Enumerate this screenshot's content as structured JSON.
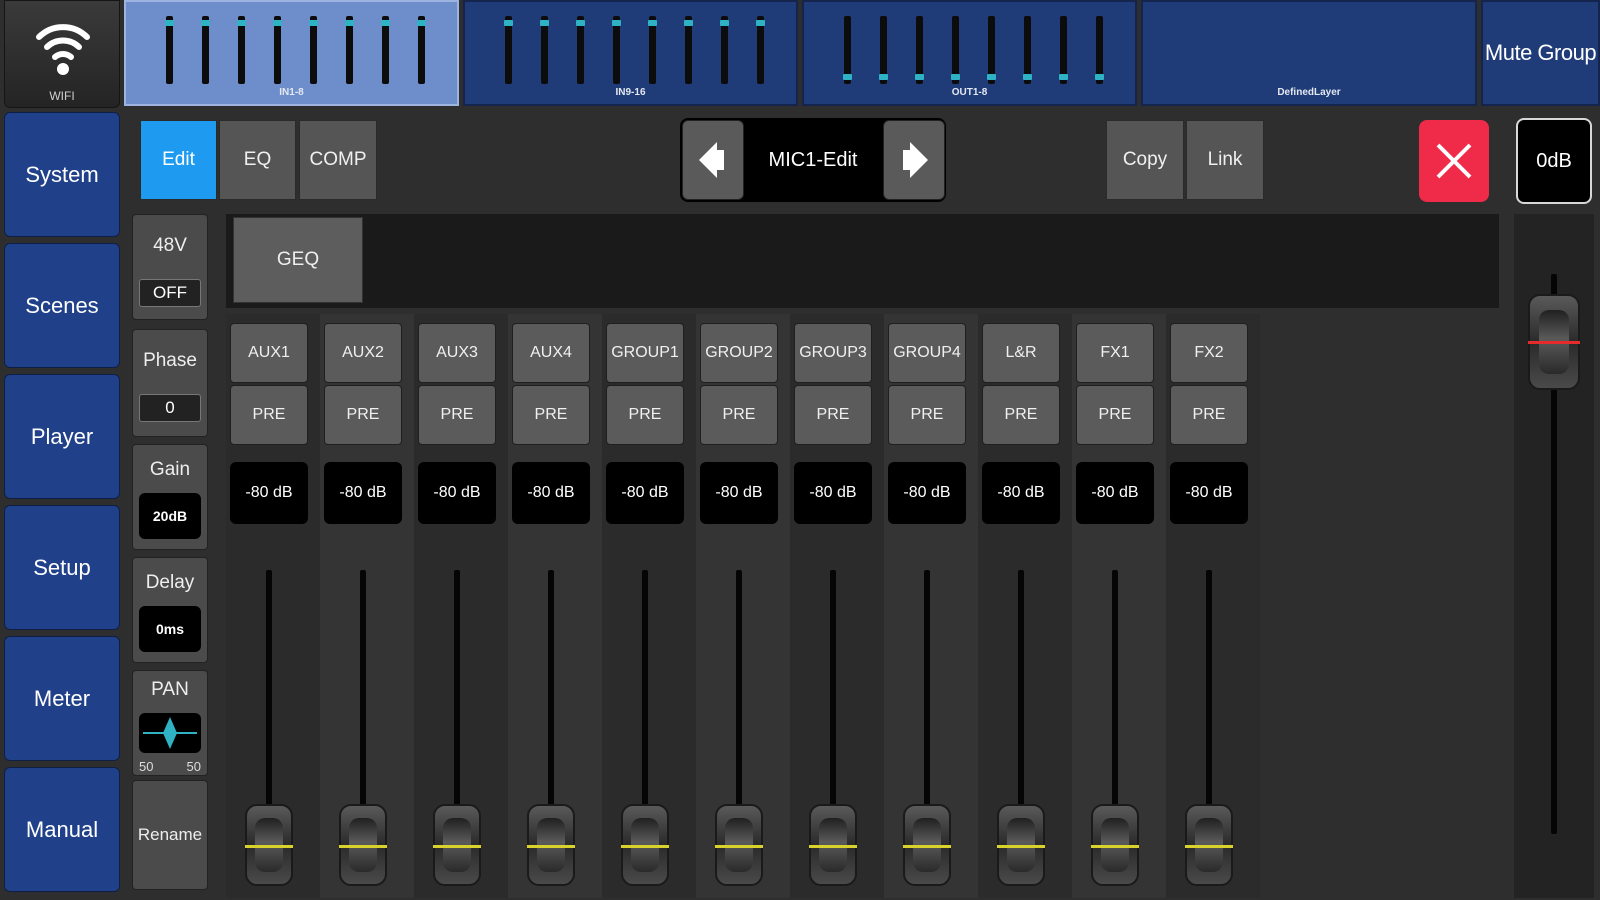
{
  "wifi": {
    "label": "WIFI"
  },
  "layers": [
    {
      "name": "IN1-8",
      "active": true,
      "faders": 8
    },
    {
      "name": "IN9-16",
      "active": false,
      "faders": 8
    },
    {
      "name": "OUT1-8",
      "active": false,
      "faders": 8
    },
    {
      "name": "DefinedLayer",
      "active": false,
      "faders": 0
    }
  ],
  "mute_group": {
    "label": "Mute Group"
  },
  "nav": [
    "System",
    "Scenes",
    "Player",
    "Setup",
    "Meter",
    "Manual"
  ],
  "toolbar": {
    "tabs": [
      "Edit",
      "EQ",
      "COMP"
    ],
    "active_tab": "Edit",
    "channel_name": "MIC1-Edit",
    "copy_label": "Copy",
    "link_label": "Link",
    "master_db": "0dB",
    "colors": {
      "accent": "#1e9bf0",
      "close": "#f02a49",
      "layer": "#1f3c78",
      "nav": "#20418a"
    }
  },
  "params": {
    "phantom": {
      "label": "48V",
      "value": "OFF"
    },
    "phase": {
      "label": "Phase",
      "value": "0"
    },
    "gain": {
      "label": "Gain",
      "value": "20dB"
    },
    "delay": {
      "label": "Delay",
      "value": "0ms"
    },
    "pan": {
      "label": "PAN",
      "left": "50",
      "right": "50"
    },
    "rename_label": "Rename"
  },
  "geq_label": "GEQ",
  "sends": [
    {
      "name": "AUX1",
      "mode": "PRE",
      "level": "-80 dB"
    },
    {
      "name": "AUX2",
      "mode": "PRE",
      "level": "-80 dB"
    },
    {
      "name": "AUX3",
      "mode": "PRE",
      "level": "-80 dB"
    },
    {
      "name": "AUX4",
      "mode": "PRE",
      "level": "-80 dB"
    },
    {
      "name": "GROUP1",
      "mode": "PRE",
      "level": "-80 dB"
    },
    {
      "name": "GROUP2",
      "mode": "PRE",
      "level": "-80 dB"
    },
    {
      "name": "GROUP3",
      "mode": "PRE",
      "level": "-80 dB"
    },
    {
      "name": "GROUP4",
      "mode": "PRE",
      "level": "-80 dB"
    },
    {
      "name": "L&R",
      "mode": "PRE",
      "level": "-80 dB"
    },
    {
      "name": "FX1",
      "mode": "PRE",
      "level": "-80 dB"
    },
    {
      "name": "FX2",
      "mode": "PRE",
      "level": "-80 dB"
    }
  ]
}
